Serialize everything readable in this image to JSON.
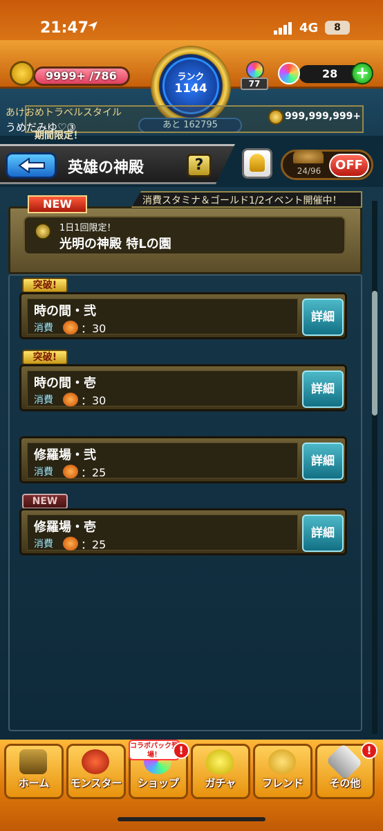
{
  "status_bar": {
    "time": "21:47",
    "network": "4G",
    "battery": "8"
  },
  "header": {
    "stamina": "9999+ /786",
    "rank_label": "ランク",
    "rank_value": "1144",
    "rank_next": "あと 162795",
    "orb_small_count": "77",
    "orb_count": "28",
    "plus_label": "+",
    "user_title": "あけおめトラベルスタイル",
    "user_name": "うめだみゆ♡③",
    "gold": "999,999,999+",
    "ticker_text": "期間限定！"
  },
  "titlebar": {
    "back_label": "",
    "title": "英雄の神殿",
    "help_label": "?",
    "auto_count": "24/96",
    "off_label": "OFF"
  },
  "event": {
    "banner": "消費スタミナ＆ゴールド1/2イベント開催中！",
    "new_label": "NEW",
    "sub": "1日1回限定！",
    "title": "光明の神殿 特Lの園"
  },
  "quests": [
    {
      "badge": "突破!",
      "name": "時の間・弐",
      "cost_label": "消費",
      "stamina": "：30",
      "detail": "詳細"
    },
    {
      "badge": "突破!",
      "name": "時の間・壱",
      "cost_label": "消費",
      "stamina": "：30",
      "detail": "詳細"
    },
    {
      "badge": "",
      "name": "修羅場・弐",
      "cost_label": "消費",
      "stamina": "：25",
      "detail": "詳細"
    },
    {
      "badge": "NEW",
      "name": "修羅場・壱",
      "cost_label": "消費",
      "stamina": "：25",
      "detail": "詳細"
    }
  ],
  "nav": {
    "home": "ホーム",
    "monster": "モンスター",
    "shop": "ショップ",
    "gacha": "ガチャ",
    "friend": "フレンド",
    "other": "その他",
    "collab_badge": "コラボパック登場！",
    "alert": "!"
  },
  "colors": {
    "accent_orange": "#e07a0a",
    "detail_teal": "#4cb8c8",
    "off_red": "#b81a10"
  }
}
